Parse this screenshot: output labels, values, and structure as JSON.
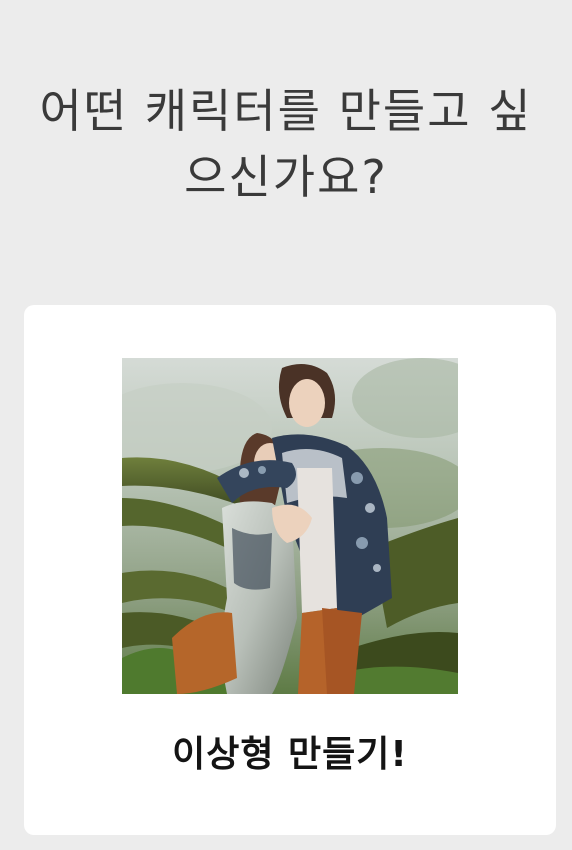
{
  "question": {
    "title": "어떤 캐릭터를 만들고 싶으신가요?"
  },
  "character_card": {
    "label": "이상형 만들기!"
  }
}
